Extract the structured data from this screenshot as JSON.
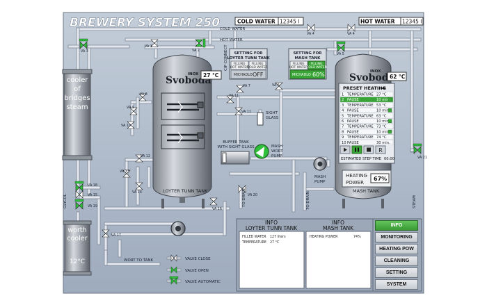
{
  "title": "BREWERY SYSTEM 250",
  "cold_water": {
    "label": "COLD WATER",
    "value": "12345 l",
    "pipe_label": "COLD WATER"
  },
  "hot_water": {
    "label": "HOT WATER",
    "value": "12345 l",
    "pipe_label": "HOT WATER"
  },
  "valves": {
    "va1": "VA 1",
    "va2": "VA 2",
    "va3": "VA 3",
    "va4a": "VA 4",
    "va4b": "VA 4",
    "va5": "VA 5",
    "va6": "VA 6",
    "va7": "VA 7",
    "va8": "VA 8",
    "va9": "VA 9",
    "va10": "VA 10",
    "va11a": "VA 11",
    "va11b": "VA 11",
    "va12": "VA 12",
    "va13": "VA 13",
    "va14": "VA 14",
    "va15": "VA 15",
    "va16": "VA 16",
    "va17": "VA 17",
    "va18": "VA 18",
    "va19": "VA 19",
    "va20": "VA 20",
    "va21": "VA 21"
  },
  "cooler_bridges": {
    "label_lines": [
      "cooler",
      "of",
      "bridges",
      "steam"
    ]
  },
  "worth_cooler": {
    "label_lines": [
      "worth",
      "cooler"
    ],
    "temperature": "12°C"
  },
  "loyter_tank": {
    "brand": "Svoboda",
    "brand_small": "INOX",
    "temperature": "27 °C",
    "name": "LOYTER TUNN TANK",
    "setting": {
      "title_lines": [
        "SETTING FOR",
        "LOYTER TUNN TANK"
      ],
      "col1": [
        "FILLING",
        "HOT WATER"
      ],
      "col2": [
        "FILLING",
        "COLD WATER"
      ],
      "mode": "MICHADLO",
      "state": "OFF"
    }
  },
  "mash_tank": {
    "brand": "Svoboda",
    "brand_small": "INOX",
    "temperature": "62 °C",
    "name": "MASH TANK",
    "setting": {
      "title_lines": [
        "SETTING FOR",
        "MASH TANK"
      ],
      "col1": [
        "FILLING",
        "HOT WATER"
      ],
      "col2": [
        "FILLING",
        "COLD WATER"
      ],
      "mode": "MICHADLO",
      "state": "60%"
    }
  },
  "preset": {
    "title": "PRESET HEATING",
    "number": "4",
    "steps": [
      {
        "n": "1",
        "name": "TEMPERATURE",
        "value": "27 °C",
        "active": false,
        "flag": false
      },
      {
        "n": "2",
        "name": "PAUSE",
        "value": "10 min.",
        "active": true,
        "flag": true
      },
      {
        "n": "3",
        "name": "TEMPERATURE",
        "value": "53 °C",
        "active": false,
        "flag": false
      },
      {
        "n": "4",
        "name": "PAUSE",
        "value": "10 min.",
        "active": false,
        "flag": true
      },
      {
        "n": "5",
        "name": "TEMPERATURE",
        "value": "63 °C",
        "active": false,
        "flag": false
      },
      {
        "n": "6",
        "name": "PAUSE",
        "value": "10 min.",
        "active": false,
        "flag": true
      },
      {
        "n": "7",
        "name": "TEMPERATURE",
        "value": "73 °C",
        "active": false,
        "flag": false
      },
      {
        "n": "8",
        "name": "PAUSE",
        "value": "10 min.",
        "active": false,
        "flag": true
      },
      {
        "n": "9",
        "name": "TEMPERATURE",
        "value": "74 °C",
        "active": false,
        "flag": false
      },
      {
        "n": "10",
        "name": "PAUSE",
        "value": "30 min.",
        "active": false,
        "flag": false
      }
    ],
    "estimated_label": "ESTIMATED STEP TIME",
    "estimated_value": "00:00",
    "reset_glyph": "R"
  },
  "heating": {
    "label_lines": [
      "HEATING",
      "POWER"
    ],
    "value": "67%"
  },
  "labels": {
    "buffer_tank": [
      "BUFFER TANK",
      "WITH SIGHT GLASS"
    ],
    "mash_wort_pump": [
      "MASH",
      "WORT",
      "PUMP"
    ],
    "mash_pump": [
      "MASH",
      "PUMP"
    ],
    "sight_glass": [
      "SIGHT",
      "GLASS"
    ],
    "cip_connect": "CIP CONNECT",
    "glycol": "GLYCOL",
    "steam": "STEAM",
    "to_drain_1": "TO DRAIN",
    "to_drain_2": "TO DRAIN",
    "wort_to_tank": "WORT TO TANK"
  },
  "legend": {
    "valve_close": "VALVE CLOSE",
    "valve_open": "VALVE OPEN",
    "valve_automatic": "VALVE AUTOMATIC"
  },
  "info_loyter": {
    "title_lines": [
      "INFO",
      "LOYTER TUNN TANK"
    ],
    "rows": [
      {
        "label": "FILLED WATER",
        "value": "127 liters"
      },
      {
        "label": "TEMPERATURE",
        "value": "27 °C"
      }
    ]
  },
  "info_mash": {
    "title_lines": [
      "INFO",
      "MASH TANK"
    ],
    "rows": [
      {
        "label": "HEATING POWER",
        "value": "74%"
      }
    ]
  },
  "menu": [
    {
      "label": "INFO",
      "active": true
    },
    {
      "label": "MONITORING",
      "active": false
    },
    {
      "label": "HEATING POW",
      "active": false
    },
    {
      "label": "CLEANING",
      "active": false
    },
    {
      "label": "SETTING",
      "active": false
    },
    {
      "label": "SYSTEM",
      "active": false
    }
  ],
  "colors": {
    "accent_green": "#3aa537",
    "panel_bg": "#a6b3c4",
    "tank_steel": "#b7bcc3"
  }
}
